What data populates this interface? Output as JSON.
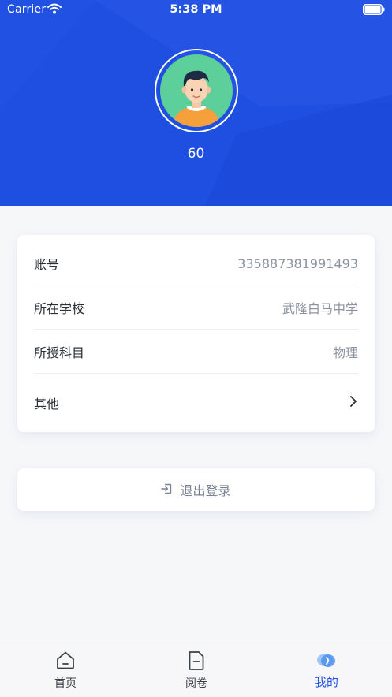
{
  "status_bar": {
    "carrier": "Carrier",
    "time": "5:38 PM"
  },
  "profile": {
    "username": "60"
  },
  "info": [
    {
      "label": "账号",
      "value": "335887381991493"
    },
    {
      "label": "所在学校",
      "value": "武隆白马中学"
    },
    {
      "label": "所授科目",
      "value": "物理"
    },
    {
      "label": "其他",
      "value": ""
    }
  ],
  "logout": {
    "label": "退出登录"
  },
  "tabs": [
    {
      "label": "首页",
      "icon": "home-icon",
      "active": false
    },
    {
      "label": "阅卷",
      "icon": "document-icon",
      "active": false
    },
    {
      "label": "我的",
      "icon": "profile-icon",
      "active": true
    }
  ],
  "colors": {
    "brand": "#1f4fe0",
    "background": "#f6f7f9",
    "muted_text": "#8c93a0"
  }
}
